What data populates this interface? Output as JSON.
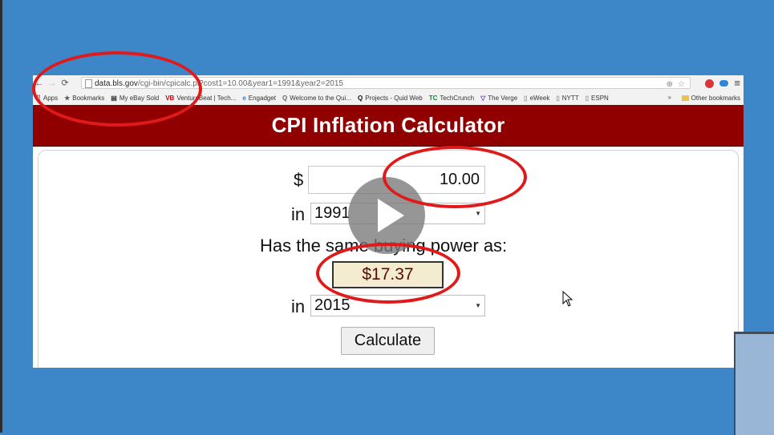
{
  "browser": {
    "url_host": "data.bls.gov",
    "url_path": "/cgi-bin/cpicalc.pl?cost1=10.00&year1=1991&year2=2015",
    "bookmarks": [
      {
        "icon": "apps-icon",
        "glyph": "⠿",
        "label": "Apps"
      },
      {
        "icon": "star-icon",
        "glyph": "★",
        "label": "Bookmarks"
      },
      {
        "icon": "ebay-icon",
        "glyph": "▤",
        "label": "My eBay Sold"
      },
      {
        "icon": "venturebeat-icon",
        "glyph": "VB",
        "label": "VentureBeat | Tech..."
      },
      {
        "icon": "engadget-icon",
        "glyph": "e",
        "label": "Engadget"
      },
      {
        "icon": "quid-icon",
        "glyph": "Q",
        "label": "Welcome to the Qui..."
      },
      {
        "icon": "quid-web-icon",
        "glyph": "Q",
        "label": "Projects - Quid Web"
      },
      {
        "icon": "techcrunch-icon",
        "glyph": "TC",
        "label": "TechCrunch"
      },
      {
        "icon": "verge-icon",
        "glyph": "▽",
        "label": "The Verge"
      },
      {
        "icon": "page-icon",
        "glyph": "▯",
        "label": "eWeek"
      },
      {
        "icon": "page-icon",
        "glyph": "▯",
        "label": "NYTT"
      },
      {
        "icon": "page-icon",
        "glyph": "▯",
        "label": "ESPN"
      }
    ],
    "more_bookmarks": "»",
    "other_bookmarks": "Other bookmarks"
  },
  "page": {
    "title": "CPI Inflation Calculator",
    "currency_symbol": "$",
    "amount": "10.00",
    "in_label": "in",
    "year1": "1991",
    "same_label": "Has the same buying power as:",
    "result": "$17.37",
    "year2": "2015",
    "calculate_label": "Calculate"
  },
  "colors": {
    "background": "#3d87c9",
    "header": "#910000",
    "highlight_ellipse": "#e01a1a",
    "result_fill": "#f3ecd0"
  }
}
